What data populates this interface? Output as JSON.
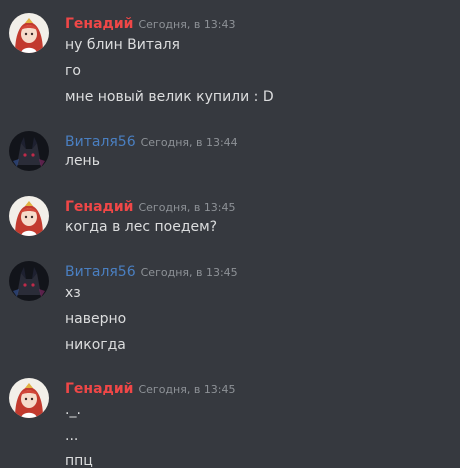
{
  "colors": {
    "background": "#36393f",
    "user_red": "#f04747",
    "user_blue": "#4a7fc1",
    "timestamp": "#8e9297",
    "message_text": "#dcddde"
  },
  "groups": [
    {
      "username": "Генадий",
      "timestamp": "Сегодня, в 13:43",
      "avatar_icon": "anime-girl-red-hair-avatar",
      "messages": [
        "ну блин Виталя",
        "го",
        "мне новый велик купили : D"
      ]
    },
    {
      "username": "Виталя56",
      "timestamp": "Сегодня, в 13:44",
      "avatar_icon": "dark-wolf-avatar",
      "messages": [
        "лень"
      ]
    },
    {
      "username": "Генадий",
      "timestamp": "Сегодня, в 13:45",
      "avatar_icon": "anime-girl-red-hair-avatar",
      "messages": [
        "когда в лес поедем?"
      ]
    },
    {
      "username": "Виталя56",
      "timestamp": "Сегодня, в 13:45",
      "avatar_icon": "dark-wolf-avatar",
      "messages": [
        "хз",
        "наверно",
        "никогда"
      ]
    },
    {
      "username": "Генадий",
      "timestamp": "Сегодня, в 13:45",
      "avatar_icon": "anime-girl-red-hair-avatar",
      "messages": [
        "._.",
        "...",
        "ппц"
      ]
    }
  ]
}
